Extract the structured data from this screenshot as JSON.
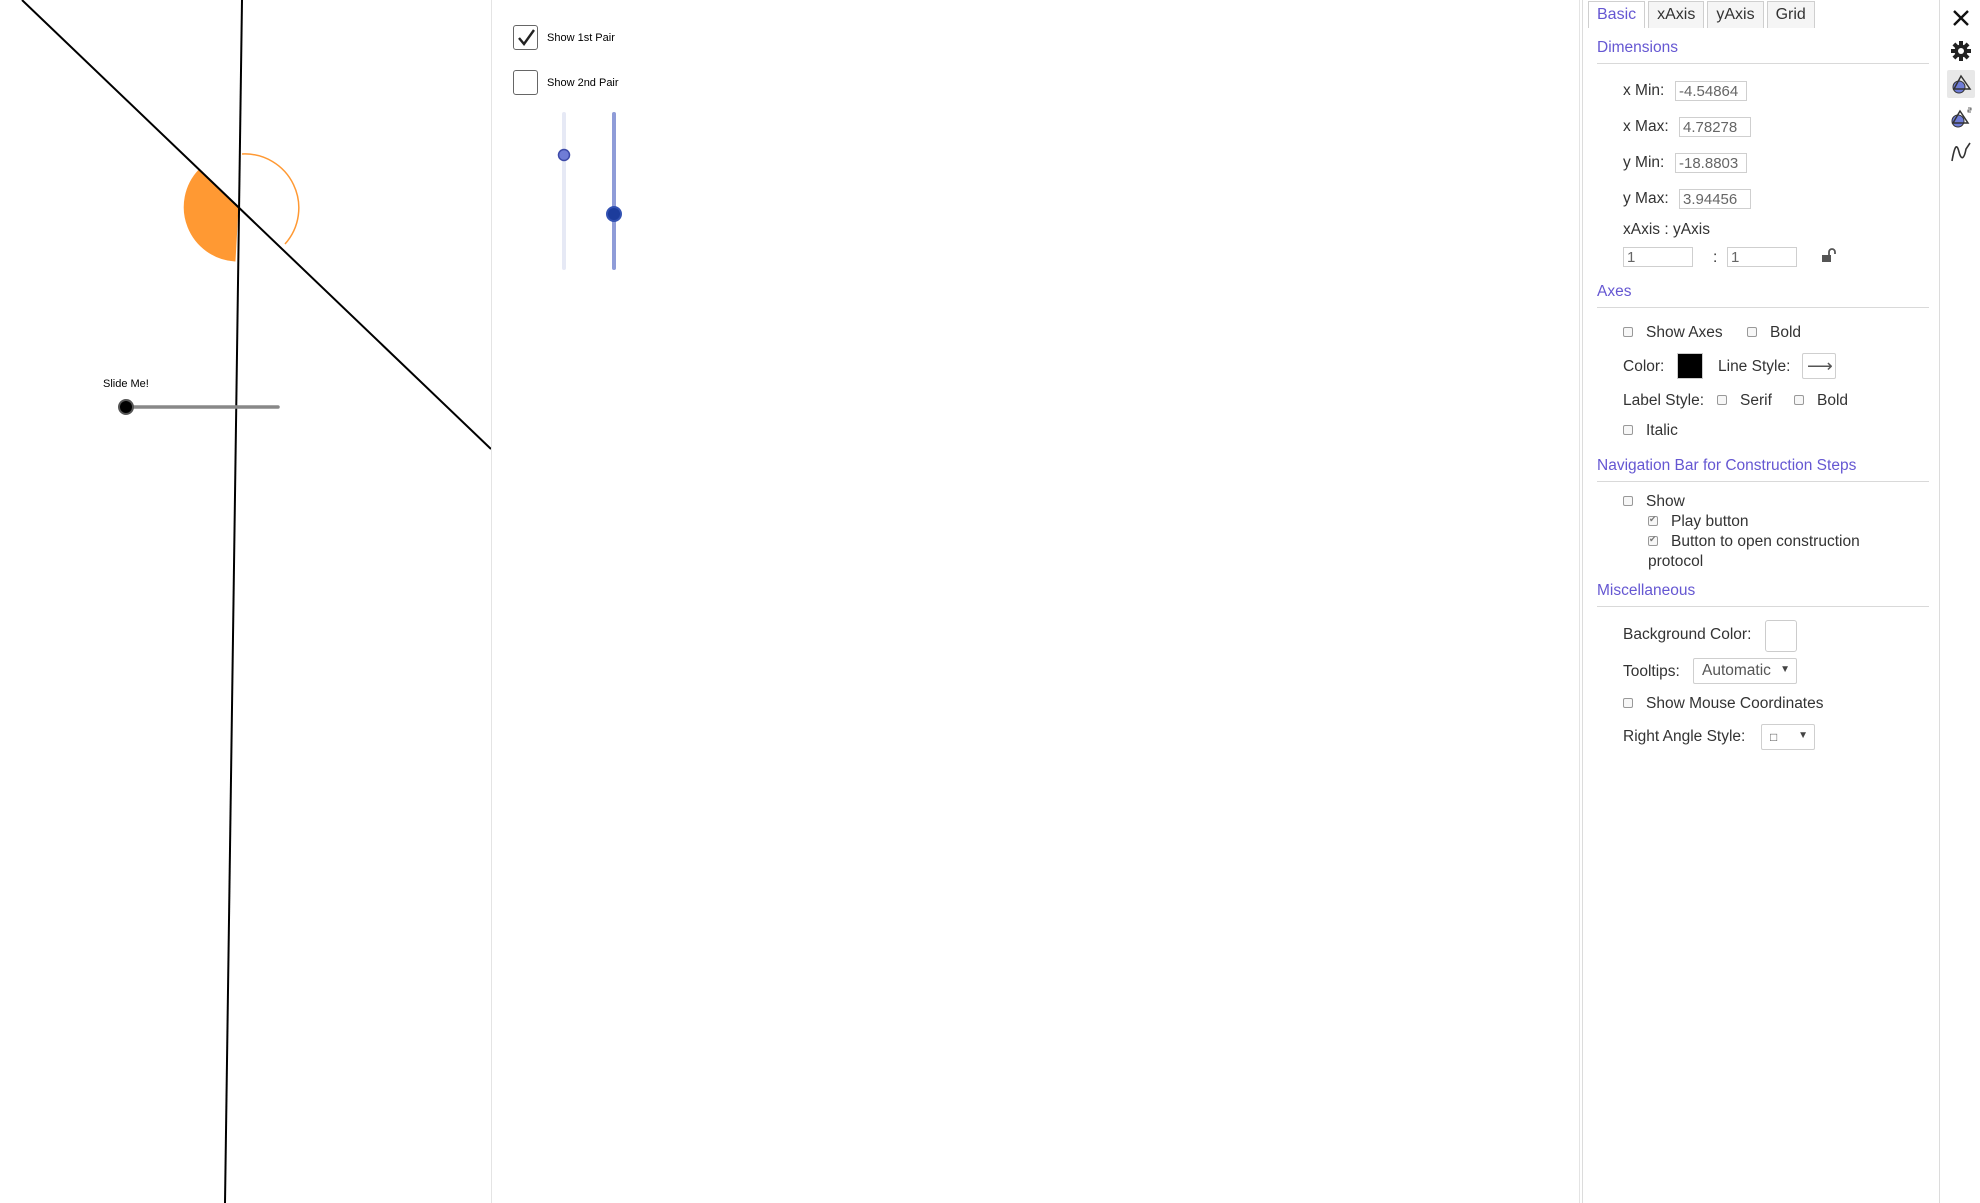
{
  "graphics1": {
    "slider_caption": "Slide Me!",
    "colors": {
      "angle_fill": "#ff9933",
      "line": "#000000",
      "slider_track": "#888888"
    }
  },
  "graphics2": {
    "checkbox1": {
      "label": "Show 1st Pair",
      "checked": true
    },
    "checkbox2": {
      "label": "Show 2nd Pair",
      "checked": false
    },
    "sliders": [
      {
        "name": "slider-a",
        "value_fraction": 0.73,
        "color": "#6f7cd6"
      },
      {
        "name": "slider-b",
        "value_fraction": 0.35,
        "color": "#1c3c9c"
      }
    ]
  },
  "settings": {
    "tabs": [
      {
        "label": "Basic",
        "active": true
      },
      {
        "label": "xAxis",
        "active": false
      },
      {
        "label": "yAxis",
        "active": false
      },
      {
        "label": "Grid",
        "active": false
      }
    ],
    "dimensions": {
      "title": "Dimensions",
      "x_min_label": "x Min:",
      "x_min": "-4.54864",
      "x_max_label": "x Max:",
      "x_max": "4.78278",
      "y_min_label": "y Min:",
      "y_min": "-18.8803",
      "y_max_label": "y Max:",
      "y_max": "3.94456",
      "ratio_label": "xAxis : yAxis",
      "ratio_x": "1",
      "ratio_sep": ":",
      "ratio_y": "1"
    },
    "axes": {
      "title": "Axes",
      "show_axes_label": "Show Axes",
      "show_axes": false,
      "bold_label": "Bold",
      "bold": false,
      "color_label": "Color:",
      "color": "#000000",
      "line_style_label": "Line Style:",
      "line_style_glyph": "⟶",
      "label_style_label": "Label Style:",
      "serif_label": "Serif",
      "serif": false,
      "label_bold_label": "Bold",
      "label_bold": false,
      "italic_label": "Italic",
      "italic": false
    },
    "navigation": {
      "title": "Navigation Bar for Construction Steps",
      "show_label": "Show",
      "show": false,
      "play_label": "Play button",
      "play": true,
      "protocol_label_1": "Button to open construction",
      "protocol_label_2": "protocol",
      "protocol": true
    },
    "misc": {
      "title": "Miscellaneous",
      "bg_color_label": "Background Color:",
      "bg_color": "#ffffff",
      "tooltips_label": "Tooltips:",
      "tooltips_value": "Automatic",
      "mouse_coords_label": "Show Mouse Coordinates",
      "mouse_coords": false,
      "right_angle_label": "Right Angle Style:",
      "right_angle_value": "□"
    }
  },
  "rail": {
    "icons": [
      "close-icon",
      "gear-icon",
      "graphics-view-icon",
      "graphics-view-2-icon",
      "function-icon"
    ]
  }
}
